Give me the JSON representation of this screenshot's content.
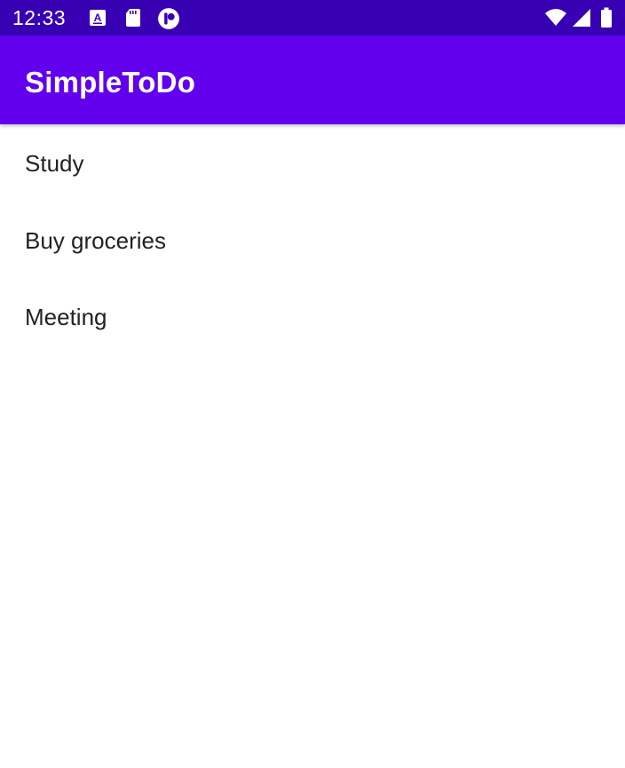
{
  "status_bar": {
    "time": "12:33",
    "left_icons": [
      "font-a-icon",
      "sd-card-icon",
      "notification-p-icon"
    ],
    "right_icons": [
      "wifi-icon",
      "signal-icon",
      "battery-icon"
    ],
    "background": "#3700b3"
  },
  "app_bar": {
    "title": "SimpleToDo",
    "background": "#6200ee"
  },
  "todo_list": {
    "items": [
      {
        "label": "Study"
      },
      {
        "label": "Buy groceries"
      },
      {
        "label": "Meeting"
      }
    ]
  }
}
